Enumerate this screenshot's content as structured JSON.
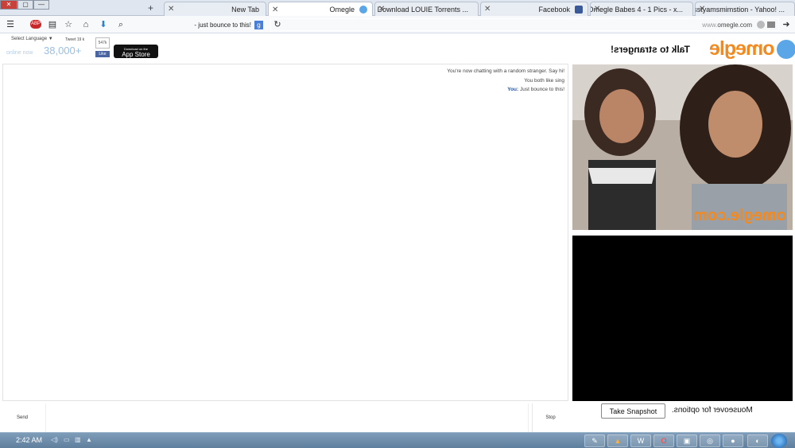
{
  "window": {
    "buttons": [
      "✕",
      "▢",
      "—"
    ]
  },
  "tabs": [
    {
      "title": "sstyamsmimstion - Yahoo! ...",
      "icon": "yahoo-icon",
      "color": "#7b0099"
    },
    {
      "title": "Omegle Babes 4 - 1 Pics - x...",
      "icon": "owl-icon",
      "color": "#d9a23b"
    },
    {
      "title": "Facebook",
      "icon": "facebook-icon",
      "color": "#3b5998"
    },
    {
      "title": "Download LOUIE Torrents ...",
      "icon": "torrent-icon",
      "color": "#d9b23b"
    },
    {
      "title": "Omegle",
      "icon": "omegle-icon",
      "color": "#5aa6e6",
      "active": true
    },
    {
      "title": "New Tab",
      "icon": "",
      "color": ""
    }
  ],
  "navbar": {
    "url_dim": "www.",
    "url": "omegle.com",
    "search_text": "- just bounce to this!",
    "search_badge": "g"
  },
  "header": {
    "logo": "omegle",
    "tagline": "Talk to strangers!",
    "appstore_small": "Download on the",
    "appstore_big": "App Store",
    "online_count": "38,000+",
    "online_label": "online now",
    "language": "Select Language ▼",
    "tweet": "Tweet",
    "fb_like": "Like",
    "like_count": "547k",
    "tweet_count": "19 k"
  },
  "chat": {
    "lines": [
      {
        "text": "You're now chatting with a random stranger. Say hi!"
      },
      {
        "text": "You both like sing"
      },
      {
        "speaker": "You:",
        "text": " Just bounce to this!"
      }
    ],
    "stop_label": "Stop",
    "send_label": "Send"
  },
  "video": {
    "watermark": "omegle.com",
    "snapshot_label": "Take Snapshot",
    "mouseover_label": "Mouseover for options."
  },
  "taskbar": {
    "clock": "2:42 AM"
  }
}
